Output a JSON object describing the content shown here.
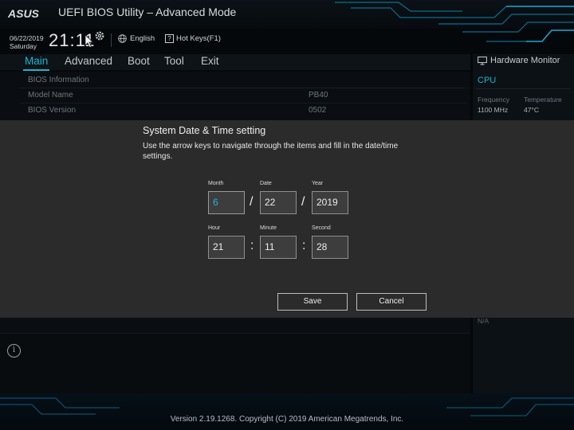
{
  "header": {
    "brand": "ASUS",
    "app_title": "UEFI BIOS Utility – Advanced Mode",
    "date": "06/22/2019",
    "day": "Saturday",
    "time": "21:11",
    "language": "English",
    "hotkeys": "Hot Keys(F1)"
  },
  "menu": {
    "tabs": [
      "Main",
      "Advanced",
      "Boot",
      "Tool",
      "Exit"
    ],
    "active": "Main"
  },
  "main": {
    "section": "BIOS Information",
    "rows": [
      {
        "label": "Model Name",
        "value": "PB40"
      },
      {
        "label": "BIOS Version",
        "value": "0502"
      }
    ]
  },
  "hardware_monitor": {
    "title": "Hardware Monitor",
    "cpu_title": "CPU",
    "frequency_label": "Frequency",
    "frequency_value": "1100 MHz",
    "temperature_label": "Temperature",
    "temperature_value": "47°C",
    "na": "N/A"
  },
  "dialog": {
    "title": "System Date & Time setting",
    "description": "Use the arrow keys to navigate through the items and fill in the date/time settings.",
    "labels": {
      "month": "Month",
      "date": "Date",
      "year": "Year",
      "hour": "Hour",
      "minute": "Minute",
      "second": "Second"
    },
    "values": {
      "month": "6",
      "date": "22",
      "year": "2019",
      "hour": "21",
      "minute": "11",
      "second": "28"
    },
    "date_sep": "/",
    "time_sep": ":",
    "save": "Save",
    "cancel": "Cancel"
  },
  "footer": {
    "text": "Version 2.19.1268. Copyright (C) 2019 American Megatrends, Inc."
  },
  "colors": {
    "accent": "#18b6d4",
    "dialog_bg": "#2b2b2b",
    "background": "#05080b"
  },
  "icons": [
    "gear-icon",
    "globe-icon",
    "help-icon",
    "monitor-icon",
    "info-icon",
    "mouse-cursor-icon"
  ]
}
